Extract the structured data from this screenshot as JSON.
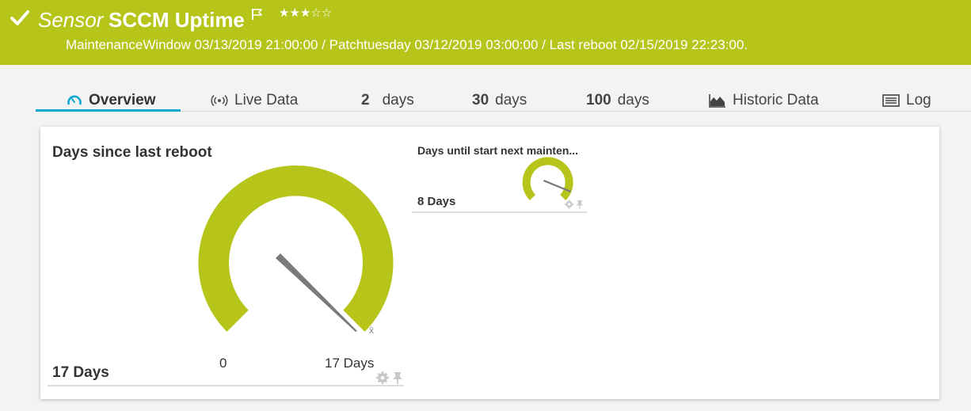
{
  "header": {
    "prefix": "Sensor",
    "name": "SCCM Uptime",
    "stars_text": "★★★☆☆",
    "subtitle": "MaintenanceWindow 03/13/2019 21:00:00 / Patchtuesday 03/12/2019 03:00:00 / Last reboot 02/15/2019 22:23:00.",
    "priority_stars": 3
  },
  "tabs": [
    {
      "icon": "gauge-icon",
      "label": "Overview",
      "active": true
    },
    {
      "icon": "live-signal-icon",
      "label": "Live Data"
    },
    {
      "number": "2",
      "label": "days"
    },
    {
      "number": "30",
      "label": "days"
    },
    {
      "number": "100",
      "label": "days"
    },
    {
      "icon": "area-chart-icon",
      "label": "Historic Data"
    },
    {
      "icon": "log-list-icon",
      "label": "Log"
    }
  ],
  "gauges": {
    "main": {
      "title": "Days since last reboot",
      "value": "17 Days",
      "min_label": "0",
      "max_label": "17 Days",
      "mean_marker": "x̄",
      "value_fraction": 1.0
    },
    "secondary": {
      "title": "Days until start next mainten...",
      "value": "8 Days",
      "value_fraction": 1.0
    }
  },
  "colors": {
    "header_bg": "#b7c41a",
    "gauge_fill": "#b7c41a",
    "needle": "#7a7a7a",
    "tab_active": "#0da7d3"
  }
}
